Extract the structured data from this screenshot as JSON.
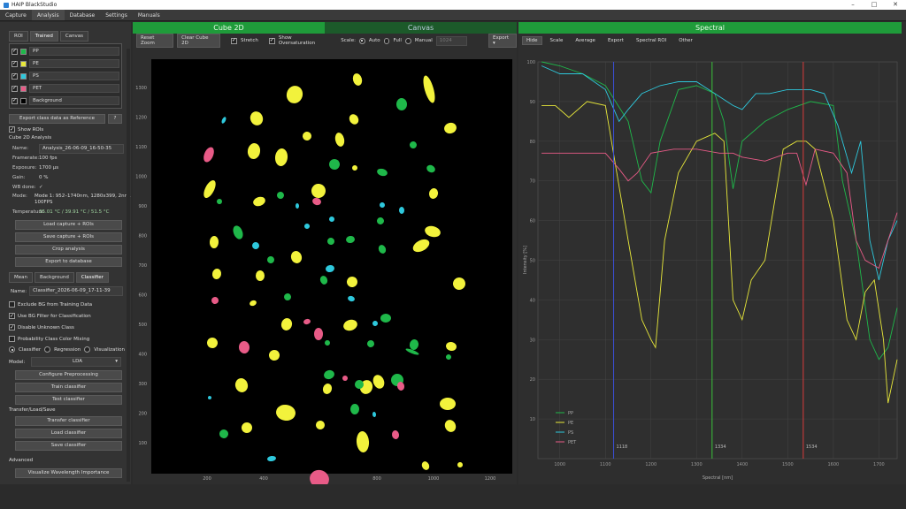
{
  "window": {
    "title": "HAIP BlackStudio"
  },
  "menu": [
    "Capture",
    "Analysis",
    "Database",
    "Settings",
    "Manuals"
  ],
  "left": {
    "tabs": [
      "ROI",
      "Trained",
      "Canvas"
    ],
    "rois": [
      {
        "name": "PP",
        "color": "#1fb84a"
      },
      {
        "name": "PE",
        "color": "#e8e83a"
      },
      {
        "name": "PS",
        "color": "#2ec8dc"
      },
      {
        "name": "PET",
        "color": "#e85b87"
      },
      {
        "name": "Background",
        "color": "#000000"
      }
    ],
    "export_ref": "Export class data as Reference",
    "help": "?",
    "show_rois": "Show ROIs",
    "cube_title": "Cube 2D Analysis",
    "info": [
      {
        "k": "Name:",
        "v": "Analysis_26-06-09_16-50-35"
      },
      {
        "k": "Framerate:",
        "v": "100 fps"
      },
      {
        "k": "Exposure:",
        "v": "1700 µs"
      },
      {
        "k": "Gain:",
        "v": "0 %"
      },
      {
        "k": "WB done:",
        "v": "✓"
      },
      {
        "k": "Mode:",
        "v": "Mode 1: 952–1740nm, 1280x399, 2nm, 100FPS"
      },
      {
        "k": "Temperature:",
        "v": "35.01 °C / 39.91 °C / 51.5 °C"
      }
    ],
    "buttons": [
      "Load capture + ROIs",
      "Save capture + ROIs",
      "Crop analysis",
      "Export to database"
    ],
    "tabs2": [
      "Mean",
      "Background",
      "Classifier"
    ],
    "classifier_name_label": "Name:",
    "classifier_name": "Classifier_2026-06-09_17-11-39",
    "checks": [
      {
        "label": "Exclude BG from Training Data",
        "on": false
      },
      {
        "label": "Use BG Filter for Classification",
        "on": true
      },
      {
        "label": "Disable Unknown Class",
        "on": true
      },
      {
        "label": "Probability Class Color Mixing",
        "on": false
      }
    ],
    "modes": [
      "Classifier",
      "Regression",
      "Visualization"
    ],
    "model_label": "Model:",
    "model": "LDA",
    "buttons2": [
      "Configure Preprocessing",
      "Train classifier",
      "Test classifier"
    ],
    "transfer_title": "Transfer/Load/Save",
    "buttons3": [
      "Transfer classifier",
      "Load classifier",
      "Save classifier"
    ],
    "advanced": "Advanced",
    "visualize": "Visualize Wavelength Importance"
  },
  "center": {
    "header_left": "Cube 2D",
    "header_right": "Canvas",
    "toolbar": {
      "reset": "Reset Zoom",
      "clear": "Clear Cube 2D",
      "stretch": "Stretch",
      "overs": "Show Oversaturation",
      "scale": "Scale:",
      "auto": "Auto",
      "full": "Full",
      "manual": "Manual",
      "manual_value": "1024",
      "export": "Export"
    },
    "yticks": [
      "1300",
      "1200",
      "1100",
      "1000",
      "900",
      "800",
      "700",
      "600",
      "500",
      "400",
      "300",
      "200",
      "100"
    ],
    "xticks": [
      "200",
      "400",
      "600",
      "800",
      "1000",
      "1200"
    ]
  },
  "spectral": {
    "header": "Spectral",
    "toolbar": [
      "Hide",
      "Scale",
      "Average",
      "Export",
      "Spectral ROI",
      "Other"
    ],
    "ylabel": "Intensity [%]",
    "xlabel": "Spectral [nm]",
    "markers": [
      {
        "label": "1118",
        "color": "#3b4fd8",
        "x": 1118
      },
      {
        "label": "1334",
        "color": "#3ac23a",
        "x": 1334
      },
      {
        "label": "1534",
        "color": "#d83b3b",
        "x": 1534
      }
    ],
    "legend": [
      {
        "name": "PP",
        "color": "#1fb84a"
      },
      {
        "name": "PE",
        "color": "#e8e83a"
      },
      {
        "name": "PS",
        "color": "#2ec8dc"
      },
      {
        "name": "PET",
        "color": "#e85b87"
      }
    ]
  },
  "chart_data": {
    "type": "line",
    "title": "",
    "xlabel": "Spectral [nm]",
    "ylabel": "Intensity [%]",
    "xlim": [
      952,
      1740
    ],
    "ylim": [
      0,
      100
    ],
    "x_ticks": [
      1000,
      1100,
      1200,
      1300,
      1400,
      1500,
      1600,
      1700
    ],
    "y_ticks": [
      10,
      20,
      30,
      40,
      50,
      60,
      70,
      80,
      90,
      100
    ],
    "grid": true,
    "legend_position": "bottom-left",
    "series": [
      {
        "name": "PP",
        "color": "#1fb84a",
        "x": [
          960,
          1000,
          1050,
          1100,
          1150,
          1180,
          1200,
          1220,
          1260,
          1300,
          1340,
          1360,
          1380,
          1400,
          1450,
          1500,
          1550,
          1600,
          1620,
          1650,
          1680,
          1700,
          1720,
          1740
        ],
        "y": [
          100,
          99,
          97,
          94,
          85,
          70,
          67,
          80,
          93,
          94,
          92,
          85,
          68,
          80,
          85,
          88,
          90,
          89,
          70,
          55,
          30,
          25,
          28,
          38
        ]
      },
      {
        "name": "PE",
        "color": "#e8e83a",
        "x": [
          960,
          990,
          1020,
          1060,
          1100,
          1150,
          1180,
          1200,
          1210,
          1230,
          1260,
          1300,
          1340,
          1360,
          1380,
          1400,
          1420,
          1450,
          1490,
          1520,
          1540,
          1560,
          1600,
          1630,
          1650,
          1670,
          1690,
          1710,
          1720,
          1740
        ],
        "y": [
          89,
          89,
          86,
          90,
          89,
          55,
          35,
          30,
          28,
          55,
          72,
          80,
          82,
          80,
          40,
          35,
          45,
          50,
          78,
          80,
          80,
          78,
          60,
          35,
          30,
          42,
          45,
          30,
          14,
          25
        ]
      },
      {
        "name": "PS",
        "color": "#2ec8dc",
        "x": [
          960,
          1000,
          1050,
          1100,
          1130,
          1150,
          1180,
          1220,
          1260,
          1300,
          1340,
          1380,
          1400,
          1430,
          1460,
          1500,
          1550,
          1580,
          1610,
          1640,
          1660,
          1680,
          1700,
          1720,
          1740
        ],
        "y": [
          99,
          97,
          97,
          93,
          85,
          88,
          92,
          94,
          95,
          95,
          92,
          89,
          88,
          92,
          92,
          93,
          93,
          92,
          84,
          72,
          80,
          55,
          45,
          55,
          60
        ]
      },
      {
        "name": "PET",
        "color": "#e85b87",
        "x": [
          960,
          1000,
          1050,
          1100,
          1130,
          1150,
          1170,
          1200,
          1250,
          1300,
          1350,
          1380,
          1400,
          1450,
          1500,
          1520,
          1540,
          1560,
          1600,
          1630,
          1650,
          1670,
          1700,
          1720,
          1740
        ],
        "y": [
          77,
          77,
          77,
          77,
          73,
          70,
          72,
          77,
          78,
          78,
          77,
          77,
          76,
          75,
          77,
          77,
          69,
          78,
          77,
          72,
          55,
          50,
          48,
          55,
          62
        ]
      }
    ]
  }
}
